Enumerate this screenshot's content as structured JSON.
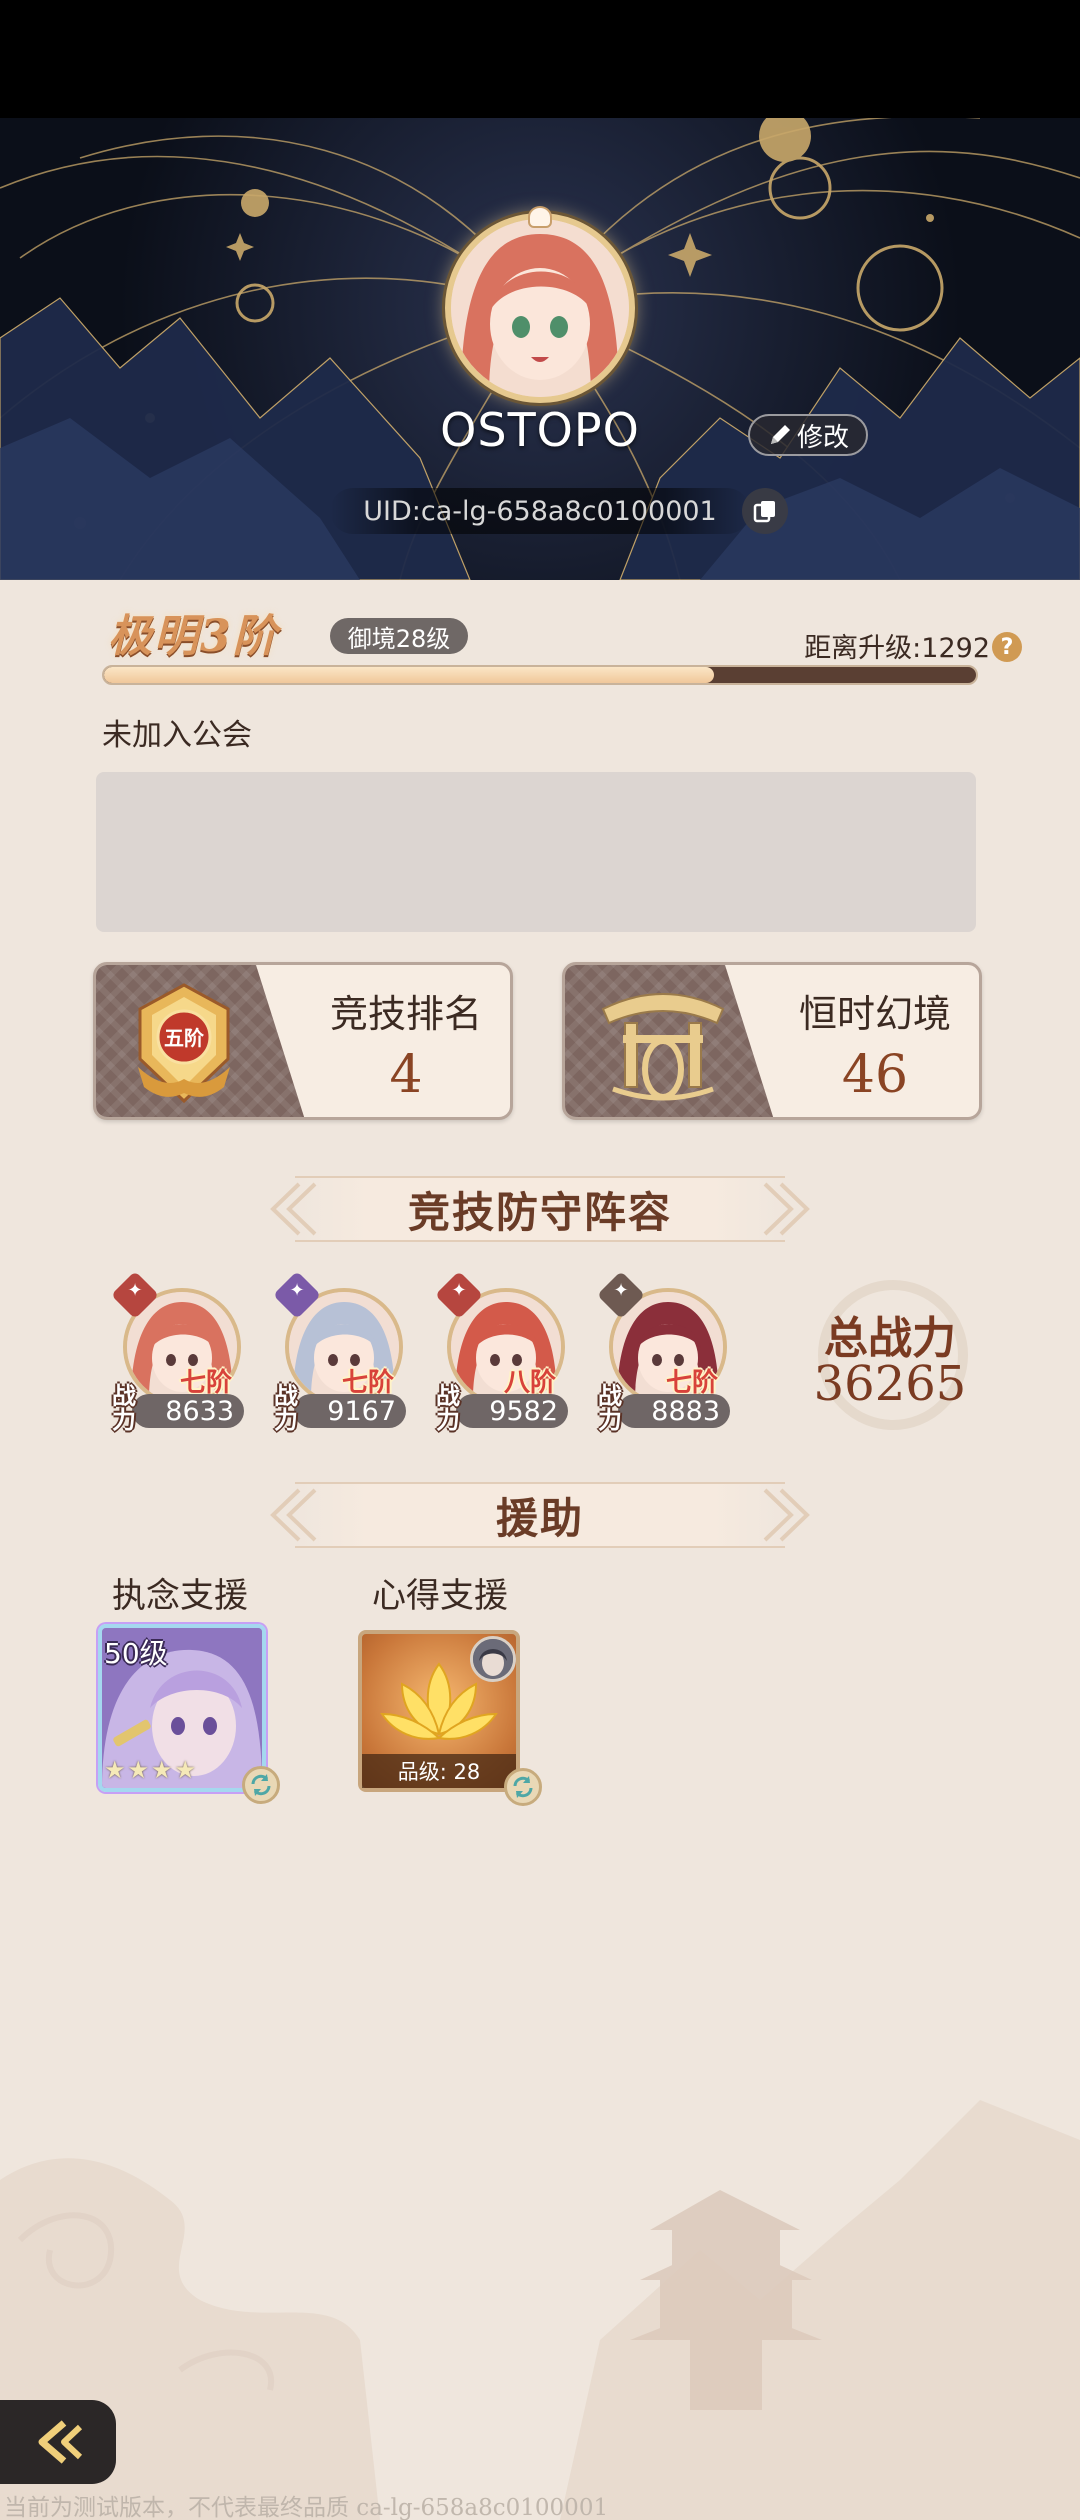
{
  "profile": {
    "name": "OSTOPO",
    "edit_label": "修改",
    "uid": "UID:ca-lg-658a8c0100001"
  },
  "rank": {
    "title": "极明3阶",
    "realm": "御境28级",
    "next_level": "距离升级:1292",
    "xp_progress": 0.7,
    "help_symbol": "?"
  },
  "guild": {
    "status": "未加入公会"
  },
  "stats": {
    "arena": {
      "label": "竞技排名",
      "value": "4",
      "emblem_text": "五阶"
    },
    "illusion": {
      "label": "恒时幻境",
      "value": "46"
    }
  },
  "defense": {
    "header": "竞技防守阵容",
    "power_tag": "战力",
    "heroes": [
      {
        "rank": "七阶",
        "power": "8633",
        "element_color": "#b6463f",
        "hair": "#d9725f"
      },
      {
        "rank": "七阶",
        "power": "9167",
        "element_color": "#7b5aa8",
        "hair": "#b7c1d6"
      },
      {
        "rank": "八阶",
        "power": "9582",
        "element_color": "#b6463f",
        "hair": "#d35a4a"
      },
      {
        "rank": "七阶",
        "power": "8883",
        "element_color": "#6e5a52",
        "hair": "#8b2f3a"
      }
    ],
    "total_power_label": "总战力",
    "total_power": "36265"
  },
  "assist": {
    "header": "援助",
    "obsession_label": "执念支援",
    "insight_label": "心得支援",
    "obsession_level": "50级",
    "obsession_stars": 4,
    "insight_grade": "品级: 28"
  },
  "footer": {
    "watermark": "当前为测试版本，不代表最终品质 ca-lg-658a8c0100001"
  },
  "colors": {
    "accent": "#8a4424",
    "gold": "#e6c98f",
    "xp_track": "#5a3f33",
    "xp_fill": "#f0c79a"
  }
}
